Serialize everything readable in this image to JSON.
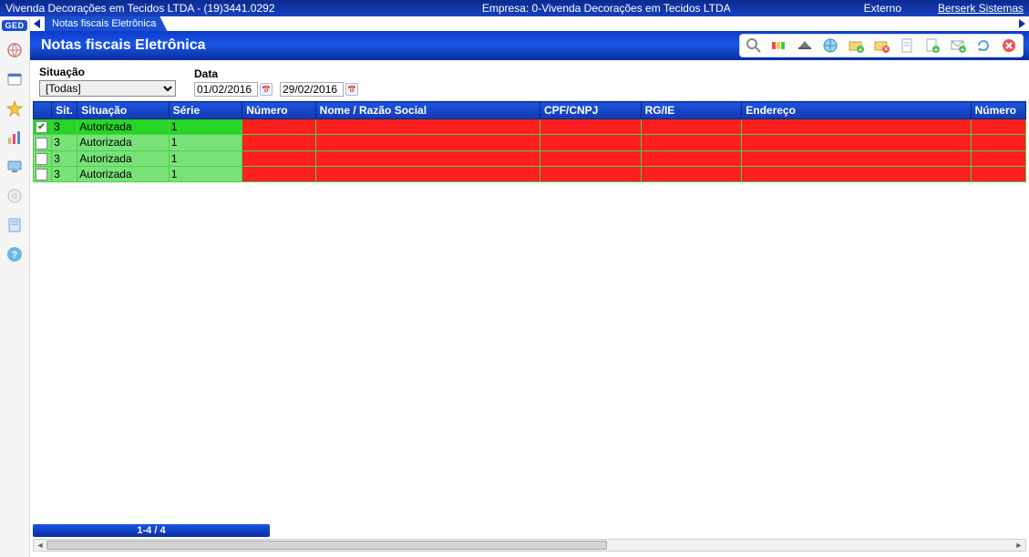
{
  "header": {
    "left": "Vivenda Decorações em Tecidos LTDA - (19)3441.0292",
    "center": "Empresa: 0-Vivenda Decorações em Tecidos LTDA",
    "right_status": "Externo",
    "link_label": "Berserk Sistemas"
  },
  "sidebar": {
    "ged_label": "GED",
    "icons": [
      "globe-icon",
      "calendar-icon",
      "star-icon",
      "chart-icon",
      "monitor-icon",
      "disc-icon",
      "book-icon",
      "help-icon"
    ]
  },
  "tab": {
    "label": "Notas fiscais Eletrônica"
  },
  "window": {
    "title": "Notas fiscais Eletrônica"
  },
  "toolbar": {
    "icons": [
      "search-icon",
      "columns-icon",
      "hat-icon",
      "globe-icon",
      "folder-add-icon",
      "folder-remove-icon",
      "doc-icon",
      "doc-add-icon",
      "mail-add-icon",
      "refresh-icon",
      "close-icon"
    ]
  },
  "filters": {
    "situacao_label": "Situação",
    "situacao_value": "[Todas]",
    "data_label": "Data",
    "date_from": "01/02/2016",
    "date_to": "29/02/2016"
  },
  "table": {
    "columns": [
      "Sit.",
      "Situação",
      "Série",
      "Número",
      "Nome / Razão Social",
      "CPF/CNPJ",
      "RG/IE",
      "Endereço",
      "Número"
    ],
    "rows": [
      {
        "checked": true,
        "sit": "3",
        "situacao": "Autorizada",
        "serie": "1"
      },
      {
        "checked": false,
        "sit": "3",
        "situacao": "Autorizada",
        "serie": "1"
      },
      {
        "checked": false,
        "sit": "3",
        "situacao": "Autorizada",
        "serie": "1"
      },
      {
        "checked": false,
        "sit": "3",
        "situacao": "Autorizada",
        "serie": "1"
      }
    ]
  },
  "footer": {
    "status": "1-4 / 4"
  }
}
